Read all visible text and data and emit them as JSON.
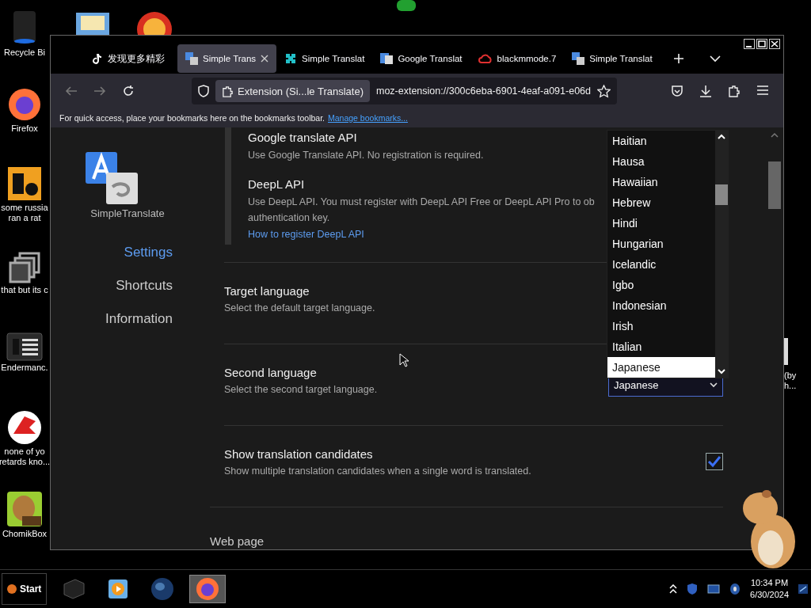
{
  "desktop_icons": [
    {
      "kind": "bin",
      "lines": [
        "Recycle Bi"
      ]
    },
    {
      "kind": "firefox",
      "lines": [
        "Firefox"
      ]
    },
    {
      "kind": "de",
      "lines": [
        "some russia",
        "ran a rat"
      ]
    },
    {
      "kind": "windows",
      "lines": [
        "that but its c"
      ]
    },
    {
      "kind": "list",
      "lines": [
        "Endermanc."
      ]
    },
    {
      "kind": "dragon",
      "lines": [
        "none of yo",
        "retards kno..."
      ]
    },
    {
      "kind": "box",
      "lines": [
        "ChomikBox"
      ]
    }
  ],
  "right_icon": {
    "lines": [
      "(by",
      "h..."
    ]
  },
  "tabs": [
    {
      "kind": "tiktok",
      "label": "发现更多精彩",
      "selected": false
    },
    {
      "kind": "translate",
      "label": "Simple Trans",
      "selected": true
    },
    {
      "kind": "puzzle",
      "label": "Simple Translat",
      "selected": false
    },
    {
      "kind": "google",
      "label": "Google Translat",
      "selected": false
    },
    {
      "kind": "cloud",
      "label": "blackmmode.7",
      "selected": false
    },
    {
      "kind": "translate",
      "label": "Simple Translat",
      "selected": false
    }
  ],
  "toolbar": {
    "identity": "Extension (Si...le Translate)",
    "url": "moz-extension://300c6eba-6901-4eaf-a091-e06d"
  },
  "bookmarks_bar": {
    "text": "For quick access, place your bookmarks here on the bookmarks toolbar.",
    "link": "Manage bookmarks..."
  },
  "sidebar": {
    "app_name": "SimpleTranslate",
    "items": [
      {
        "label": "Settings",
        "selected": true
      },
      {
        "label": "Shortcuts",
        "selected": false
      },
      {
        "label": "Information",
        "selected": false
      }
    ]
  },
  "api_options": [
    {
      "title": "Google translate API",
      "lines": [
        "Use Google Translate API. No registration is required."
      ]
    },
    {
      "title": "DeepL API",
      "lines": [
        "Use DeepL API. You must register with DeepL API Free or DeepL API Pro to ob",
        "authentication key."
      ],
      "link": "How to register DeepL API"
    }
  ],
  "settings": [
    {
      "kind": "select",
      "title": "Target language",
      "description": "Select the default target language."
    },
    {
      "kind": "select",
      "title": "Second language",
      "description": "Select the second target language.",
      "value": "Japanese"
    },
    {
      "kind": "checkbox",
      "title": "Show translation candidates",
      "description": "Show multiple translation candidates when a single word is translated.",
      "checked": true
    }
  ],
  "section_heading": "Web page",
  "dropdown": {
    "options": [
      {
        "label": "Haitian",
        "selected": false
      },
      {
        "label": "Hausa",
        "selected": false
      },
      {
        "label": "Hawaiian",
        "selected": false
      },
      {
        "label": "Hebrew",
        "selected": false
      },
      {
        "label": "Hindi",
        "selected": false
      },
      {
        "label": "Hungarian",
        "selected": false
      },
      {
        "label": "Icelandic",
        "selected": false
      },
      {
        "label": "Igbo",
        "selected": false
      },
      {
        "label": "Indonesian",
        "selected": false
      },
      {
        "label": "Irish",
        "selected": false
      },
      {
        "label": "Italian",
        "selected": false
      },
      {
        "label": "Japanese",
        "selected": true
      }
    ]
  },
  "taskbar": {
    "start": "Start",
    "apps": [
      {
        "kind": "box3d",
        "selected": false
      },
      {
        "kind": "player",
        "selected": false
      },
      {
        "kind": "globe",
        "selected": false
      },
      {
        "kind": "firefox",
        "selected": true
      }
    ],
    "time": "10:34 PM",
    "date": "6/30/2024"
  }
}
